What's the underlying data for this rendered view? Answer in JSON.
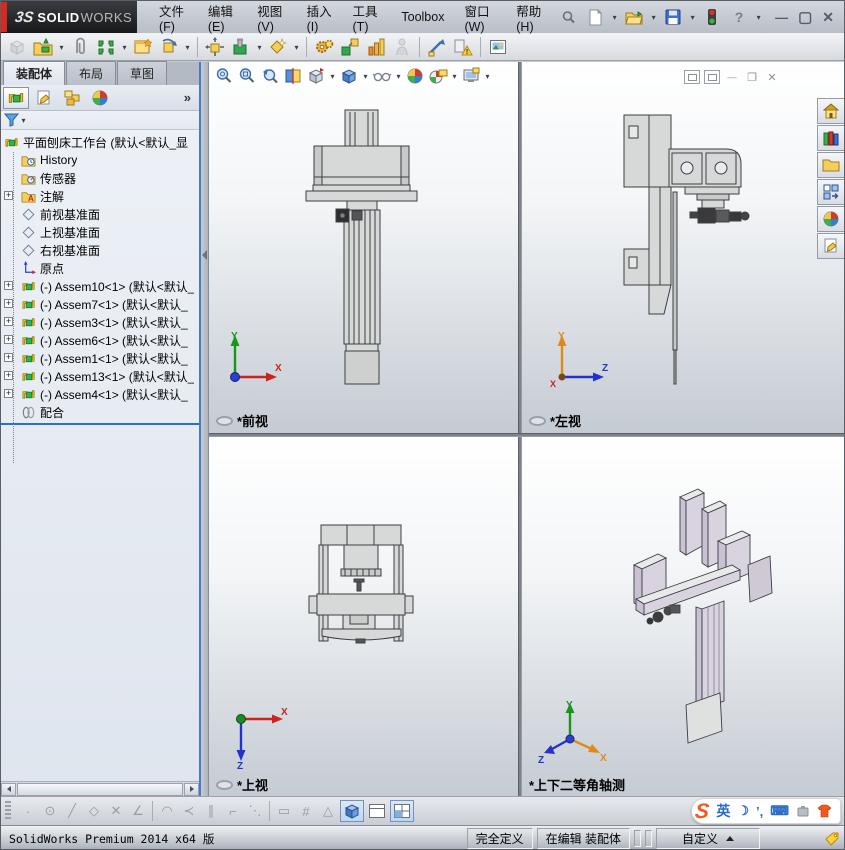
{
  "titlebar": {
    "brand_mark": "3S",
    "brand_bold": "SOLID",
    "brand_light": "WORKS",
    "menus": [
      "文件(F)",
      "编辑(E)",
      "视图(V)",
      "插入(I)",
      "工具(T)",
      "Toolbox",
      "窗口(W)",
      "帮助(H)"
    ]
  },
  "command_tabs": {
    "assembly": "装配体",
    "layout": "布局",
    "sketch": "草图"
  },
  "feature_tree": {
    "root_label": "平面刨床工作台 (默认<默认_显",
    "items": [
      {
        "label": "History"
      },
      {
        "label": "传感器"
      },
      {
        "label": "注解"
      },
      {
        "label": "前视基准面"
      },
      {
        "label": "上视基准面"
      },
      {
        "label": "右视基准面"
      },
      {
        "label": "原点"
      },
      {
        "label": "(-) Assem10<1> (默认<默认_"
      },
      {
        "label": "(-) Assem7<1> (默认<默认_"
      },
      {
        "label": "(-) Assem3<1> (默认<默认_"
      },
      {
        "label": "(-) Assem6<1> (默认<默认_"
      },
      {
        "label": "(-) Assem1<1> (默认<默认_"
      },
      {
        "label": "(-) Assem13<1> (默认<默认_"
      },
      {
        "label": "(-) Assem4<1> (默认<默认_"
      },
      {
        "label": "配合"
      }
    ]
  },
  "viewports": {
    "front": {
      "label": "*前视",
      "axis_up": "Y",
      "axis_right": "X"
    },
    "left": {
      "label": "*左视",
      "axis_up": "Y",
      "axis_right": "Z",
      "axis_origin": "X"
    },
    "top": {
      "label": "*上视",
      "axis_right": "X",
      "axis_down": "Z"
    },
    "iso": {
      "label": "*上下二等角轴测",
      "axis_up": "Y",
      "axis_se": "X",
      "axis_sw": "Z"
    }
  },
  "view_toolbar": {
    "glyphs": [
      "·",
      "⊙",
      "╱",
      "◇",
      "✕",
      "∠",
      "◠",
      "≺",
      "∥",
      "⌐",
      "⋱",
      "▭",
      "#",
      "△"
    ]
  },
  "status_bar": {
    "product": "SolidWorks Premium 2014 x64 版",
    "defined": "完全定义",
    "editing": "在编辑 装配体",
    "custom": "自定义"
  },
  "ime": {
    "logo": "S",
    "lang": "英",
    "moon": "☽",
    "comma": "’,",
    "keyboard": "⌨"
  },
  "colors": {
    "brand_red": "#d42a20",
    "accent_blue": "#2a6fd6",
    "axis_x": "#cc2222",
    "axis_y": "#18961c",
    "axis_z": "#2233cc",
    "axis_orange": "#dd8a1a",
    "ime_orange": "#f4581c",
    "status_segment_bg": "#c6cbd3"
  }
}
